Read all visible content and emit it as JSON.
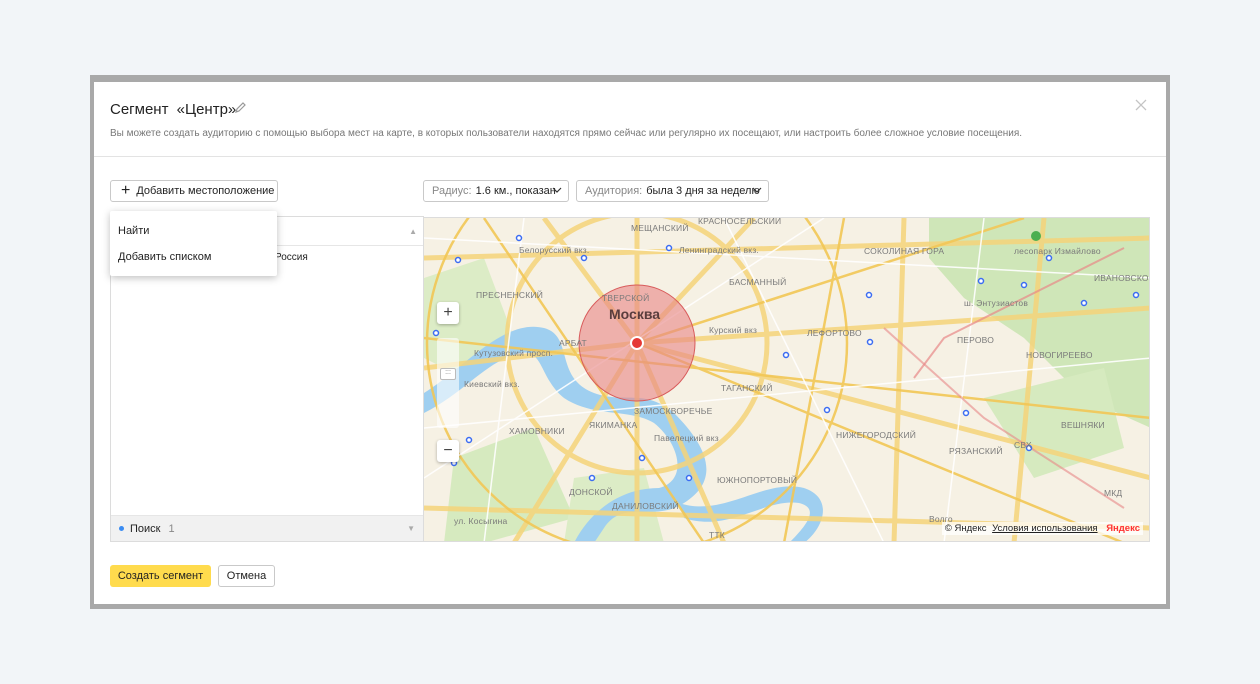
{
  "dialog": {
    "title_prefix": "Сегмент",
    "title_name": "«Центр»",
    "subtitle": "Вы можете создать аудиторию с помощью выбора мест на карте, в которых пользователи находятся прямо сейчас или регулярно их посещают, или настроить более сложное условие посещения."
  },
  "toolbar": {
    "add_location_plus": "+",
    "add_location_label": "Добавить местоположение",
    "radius_label": "Радиус:",
    "radius_value": "1.6 км., показан",
    "audience_label": "Аудитория:",
    "audience_value": "была 3 дня за неделю"
  },
  "popup_menu": {
    "items": [
      "Найти",
      "Добавить списком"
    ]
  },
  "location_list": {
    "row_text": "Россия",
    "footer_label": "Поиск",
    "footer_count": "1"
  },
  "map": {
    "city": "Москва",
    "labels": [
      "МЕЩАНСКИЙ",
      "КРАСНОСЕЛЬСКИЙ",
      "Белорусский вкз.",
      "Ленинградский вкз.",
      "СОКОЛИНАЯ ГОРА",
      "лесопарк Измайлово",
      "ПРЕСНЕНСКИЙ",
      "ТВЕРСКОЙ",
      "БАСМАННЫЙ",
      "Курский вкз",
      "ЛЕФОРТОВО",
      "ПЕРОВО",
      "НОВОГИРЕЕВО",
      "ИВАНОВСКОЕ",
      "АРБАТ",
      "ТАГАНСКИЙ",
      "Киевский вкз.",
      "ЗАМОСКВОРЕЧЬЕ",
      "ХАМОВНИКИ",
      "ЯКИМАНКА",
      "Павелецкий вкз",
      "НИЖЕГОРОДСКИЙ",
      "ВЕШНЯКИ",
      "РЯЗАНСКИЙ",
      "ДОНСКОЙ",
      "ЮЖНОПОРТОВЫЙ",
      "ДАНИЛОВСКИЙ",
      "ТТК",
      "СВХ",
      "МКД",
      "Кутузовский просп.",
      "ш. Энтузиастов",
      "ул. Косыгина",
      "Волго"
    ],
    "copyright": "© Яндекс",
    "terms": "Условия использования",
    "brand": "Яндекс",
    "zoom_in": "+",
    "zoom_out": "−",
    "zoom_handle": ":::"
  },
  "footer": {
    "create_label": "Создать сегмент",
    "cancel_label": "Отмена"
  },
  "colors": {
    "primary_button": "#ffdb4d",
    "radius_circle": "#e88787",
    "marker": "#e53935"
  }
}
